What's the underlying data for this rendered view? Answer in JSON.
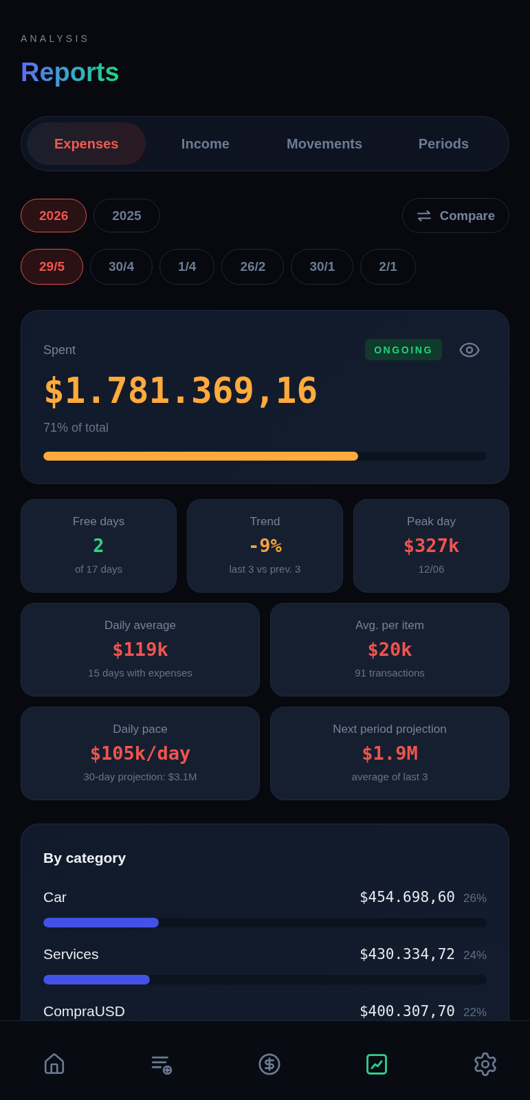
{
  "header": {
    "eyebrow": "ANALYSIS",
    "title": "Reports"
  },
  "tabs": [
    {
      "label": "Expenses",
      "selected": true
    },
    {
      "label": "Income",
      "selected": false
    },
    {
      "label": "Movements",
      "selected": false
    },
    {
      "label": "Periods",
      "selected": false
    }
  ],
  "years": [
    {
      "label": "2026",
      "selected": true
    },
    {
      "label": "2025",
      "selected": false
    }
  ],
  "compare_button": {
    "label": "Compare"
  },
  "periods": [
    {
      "label": "29/5",
      "selected": true
    },
    {
      "label": "30/4",
      "selected": false
    },
    {
      "label": "1/4",
      "selected": false
    },
    {
      "label": "26/2",
      "selected": false
    },
    {
      "label": "30/1",
      "selected": false
    },
    {
      "label": "2/1",
      "selected": false
    }
  ],
  "spent_card": {
    "label": "Spent",
    "badge": "ONGOING",
    "amount": "$1.781.369,16",
    "caption": "71% of total",
    "level": 0.71
  },
  "stats": [
    {
      "label": "Free days",
      "value": "2",
      "note": "of 17 days",
      "color": "#2ed47a"
    },
    {
      "label": "Trend",
      "value": "-9%",
      "note": "last 3 vs prev. 3",
      "color": "#f5a23c"
    },
    {
      "label": "Peak day",
      "value": "$327k",
      "note": "12/06",
      "color": "#f0534f"
    },
    {
      "label": "Daily average",
      "value": "$119k",
      "note": "15 days with expenses",
      "color": "#f0534f"
    },
    {
      "label": "Avg. per item",
      "value": "$20k",
      "note": "91 transactions",
      "color": "#f0534f"
    },
    {
      "label": "Daily pace",
      "value": "$105k/day",
      "note": "30-day projection: $3.1M",
      "color": "#f0534f"
    },
    {
      "label": "Next period projection",
      "value": "$1.9M",
      "note": "average of last 3",
      "color": "#f0534f"
    }
  ],
  "by_category": {
    "title": "By category",
    "items": [
      {
        "name": "Car",
        "amount": "$454.698,60",
        "share": "26%",
        "level": 0.26
      },
      {
        "name": "Services",
        "amount": "$430.334,72",
        "share": "24%",
        "level": 0.24
      },
      {
        "name": "CompraUSD",
        "amount": "$400.307,70",
        "share": "22%"
      }
    ]
  },
  "bottom_nav": [
    {
      "selected": false
    },
    {
      "selected": false
    },
    {
      "selected": false
    },
    {
      "selected": true
    },
    {
      "selected": false
    }
  ]
}
